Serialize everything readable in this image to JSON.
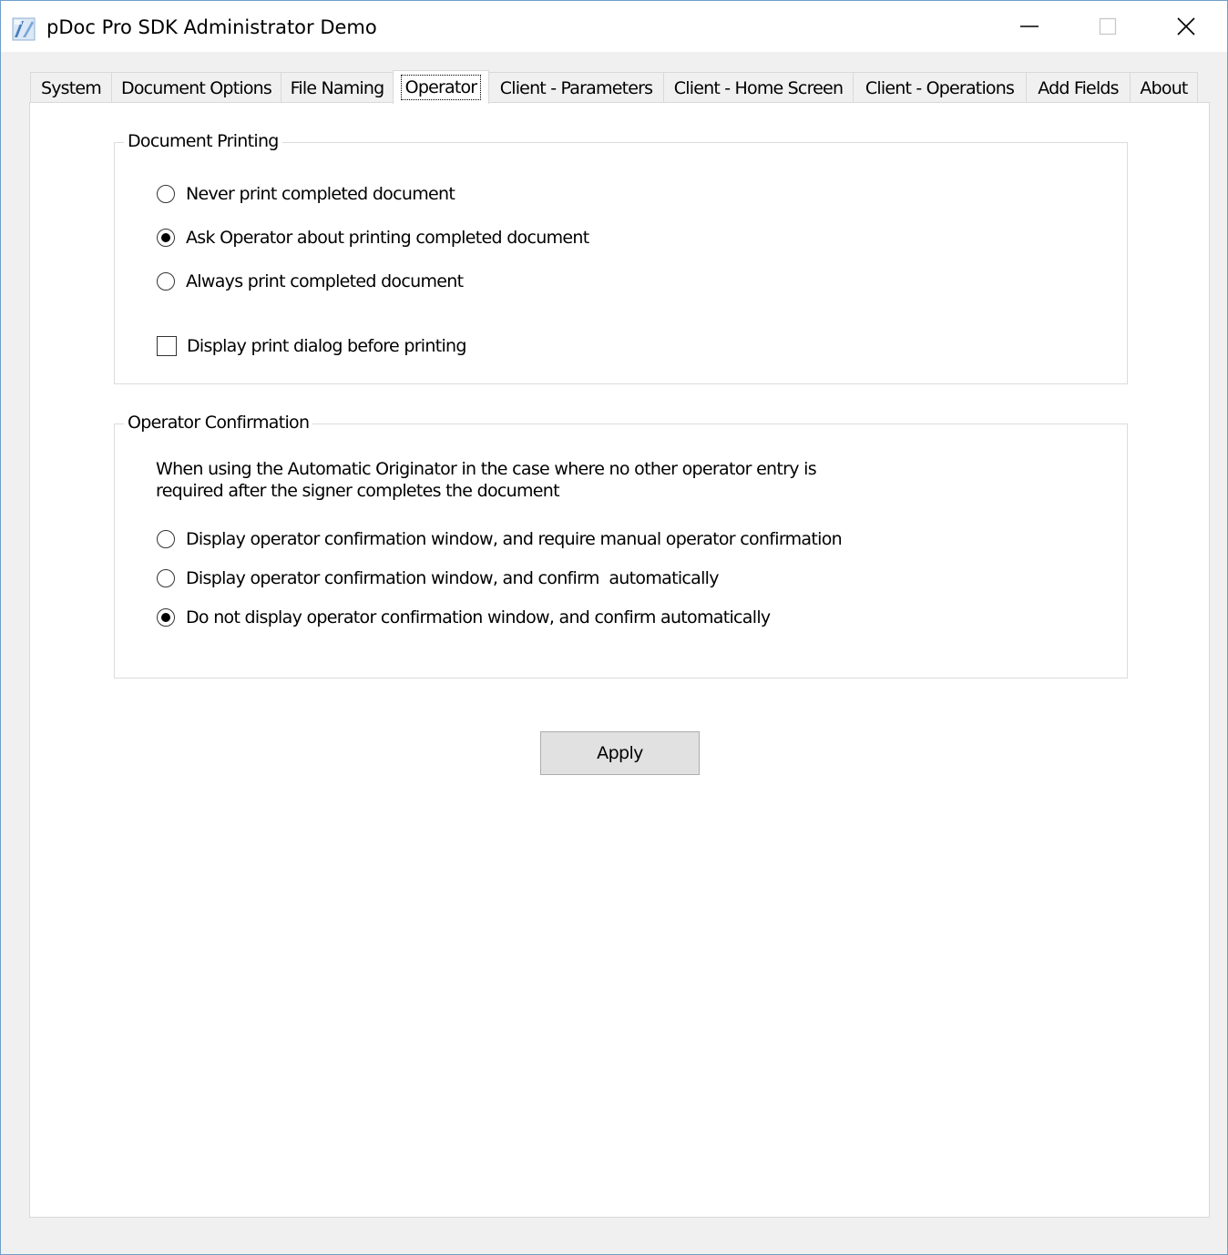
{
  "window": {
    "title": "pDoc Pro SDK Administrator Demo"
  },
  "tabs": [
    {
      "label": "System"
    },
    {
      "label": "Document Options"
    },
    {
      "label": "File Naming"
    },
    {
      "label": "Operator"
    },
    {
      "label": "Client - Parameters"
    },
    {
      "label": "Client - Home Screen"
    },
    {
      "label": "Client - Operations"
    },
    {
      "label": "Add Fields"
    },
    {
      "label": "About"
    }
  ],
  "active_tab": "Operator",
  "document_printing": {
    "title": "Document Printing",
    "options": [
      {
        "label": "Never print completed document",
        "selected": false
      },
      {
        "label": "Ask Operator about printing completed document",
        "selected": true
      },
      {
        "label": "Always print completed document",
        "selected": false
      }
    ],
    "display_dialog": {
      "label": "Display print dialog before printing",
      "checked": false
    }
  },
  "operator_confirmation": {
    "title": "Operator Confirmation",
    "description_line1": "When using the Automatic Originator in the case where no other operator entry is",
    "description_line2": "required after the signer completes the document",
    "options": [
      {
        "label": "Display operator confirmation window, and require manual operator confirmation",
        "selected": false
      },
      {
        "label": "Display operator confirmation window, and confirm  automatically",
        "selected": false
      },
      {
        "label": "Do not display operator confirmation window, and confirm automatically",
        "selected": true
      }
    ]
  },
  "apply_label": "Apply",
  "icons": {
    "app": "pdoc-app-icon",
    "minimize": "minimize-icon",
    "maximize": "maximize-icon",
    "close": "close-icon"
  }
}
